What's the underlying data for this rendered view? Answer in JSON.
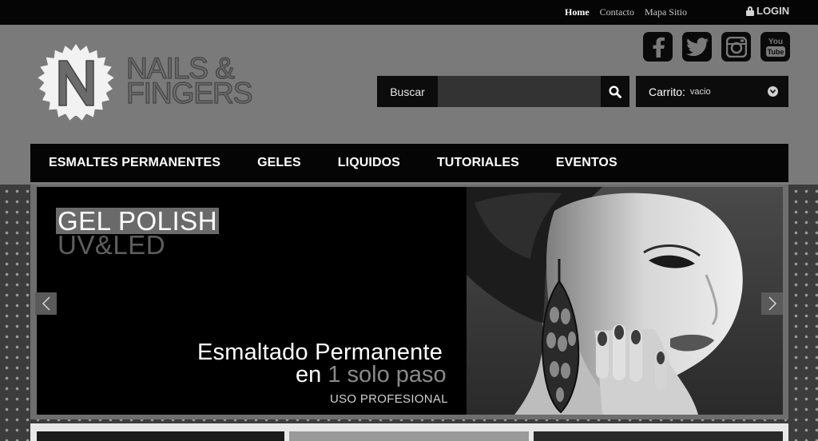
{
  "topbar": {
    "links": [
      "Home",
      "Contacto",
      "Mapa Sitio"
    ],
    "login_label": "LOGIN"
  },
  "brand": {
    "badge_letter": "N",
    "name_line1": "NAILS &",
    "name_line2": "FINGERS"
  },
  "social": [
    "facebook-icon",
    "twitter-icon",
    "instagram-icon",
    "youtube-icon"
  ],
  "social_labels": {
    "youtube_top": "You",
    "youtube_bottom": "Tube"
  },
  "search": {
    "label": "Buscar",
    "value": "",
    "placeholder": ""
  },
  "cart": {
    "label": "Carrito:",
    "status": "vacio"
  },
  "nav": {
    "items": [
      "ESMALTES PERMANENTES",
      "GELES",
      "LIQUIDOS",
      "TUTORIALES",
      "EVENTOS"
    ]
  },
  "slider": {
    "title": "GEL POLISH",
    "subtitle": "UV&LED",
    "headline_line1": "Esmaltado Permanente",
    "headline_line2_prefix": "en ",
    "headline_line2_highlight": "1 solo paso",
    "tagline": "USO PROFESIONAL",
    "prev_arrow": "‹",
    "next_arrow": "›"
  },
  "colors": {
    "page_bg": "#7a7a7a",
    "bar_bg": "#050505"
  }
}
